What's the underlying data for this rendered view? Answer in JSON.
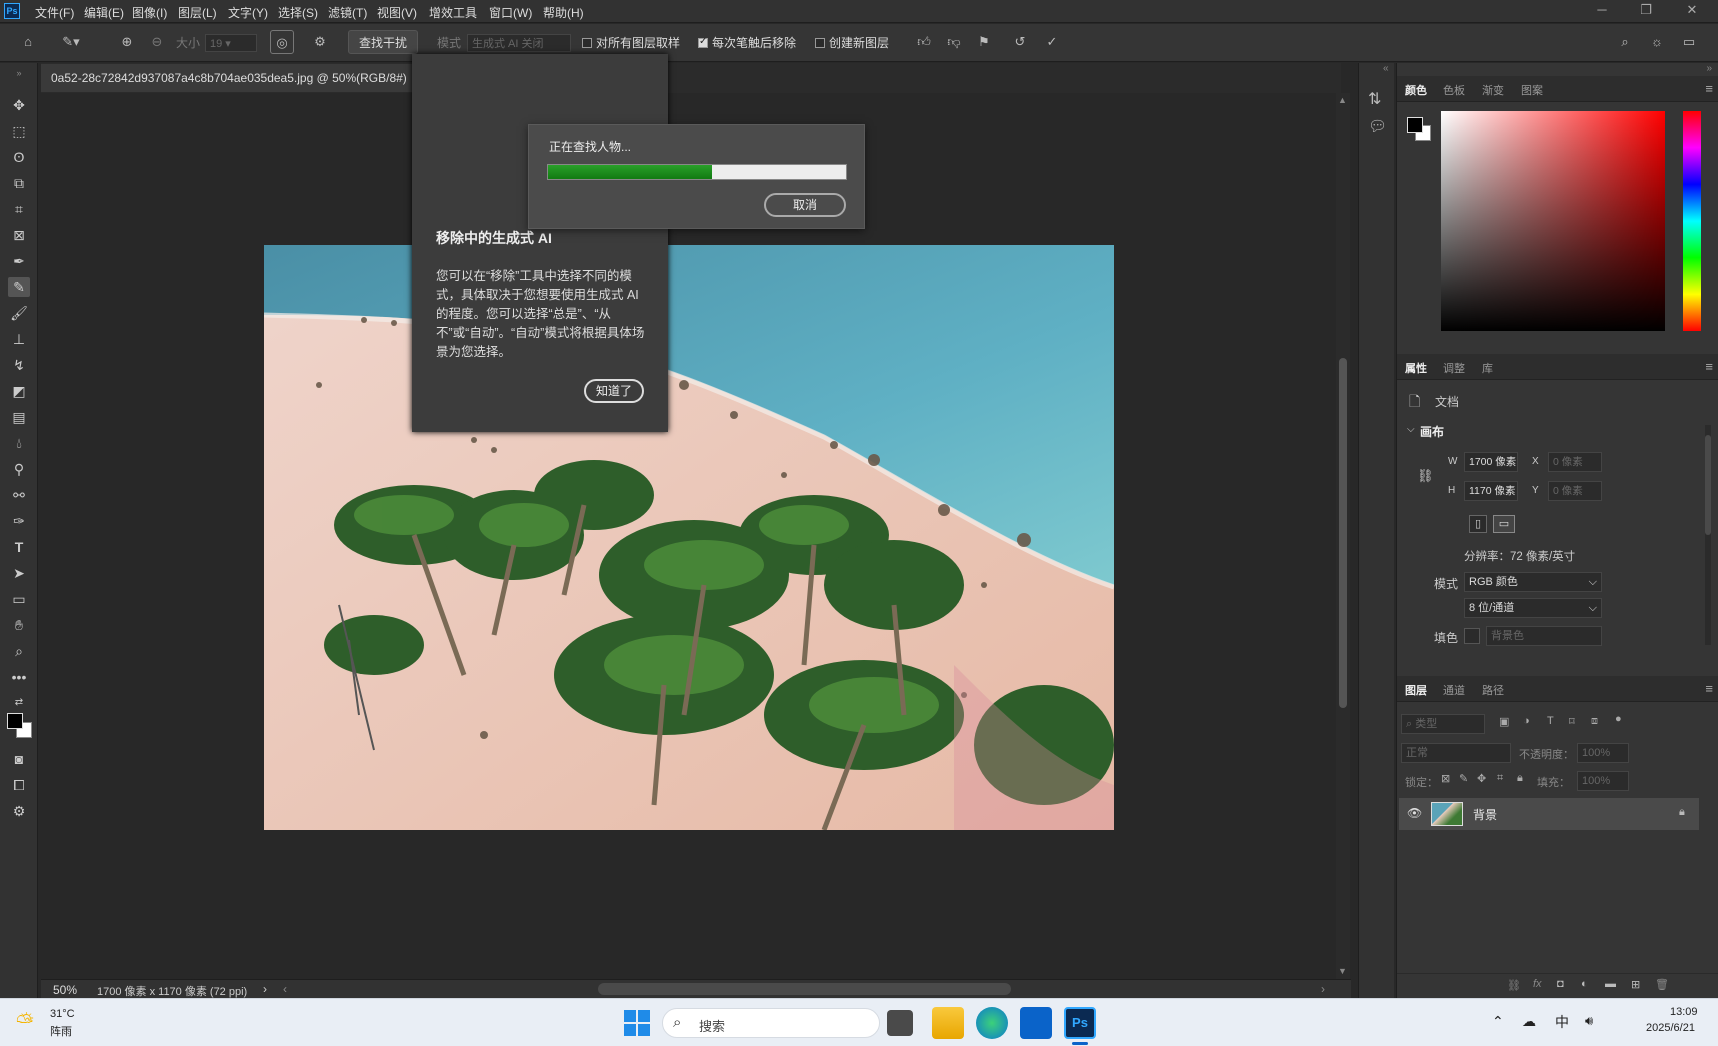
{
  "menu": [
    "文件(F)",
    "编辑(E)",
    "图像(I)",
    "图层(L)",
    "文字(Y)",
    "选择(S)",
    "滤镜(T)",
    "视图(V)",
    "增效工具",
    "窗口(W)",
    "帮助(H)"
  ],
  "options": {
    "size_label": "大小",
    "size_value": "19",
    "find_button": "查找干扰",
    "mode_label": "模式",
    "mode_value": "生成式 AI 关闭",
    "sample_all": "对所有图层取样",
    "remove_after": "每次笔触后移除",
    "new_layer": "创建新图层"
  },
  "document": {
    "tab_title": "0a52-28c72842d937087a4c8b704ae035dea5.jpg @ 50%(RGB/8#)",
    "close": "×"
  },
  "tooltip": {
    "title": "移除中的生成式 AI",
    "body": "您可以在“移除”工具中选择不同的模式，具体取决于您想要使用生成式 AI 的程度。您可以选择“总是”、“从不”或“自动”。“自动”模式将根据具体场景为您选择。",
    "button": "知道了"
  },
  "progress": {
    "text": "正在查找人物...",
    "percent": 55,
    "cancel": "取消"
  },
  "status": {
    "zoom": "50%",
    "info": "1700 像素 x 1170 像素 (72 ppi)",
    "arrow": "›"
  },
  "color_panel": {
    "tabs": [
      "颜色",
      "色板",
      "渐变",
      "图案"
    ],
    "fg": "#000000",
    "bg": "#ffffff",
    "hue": "#ff0000"
  },
  "properties": {
    "tabs": [
      "属性",
      "调整",
      "库"
    ],
    "doc_label": "文档",
    "canvas_label": "画布",
    "w_label": "W",
    "w_value": "1700 像素",
    "h_label": "H",
    "h_value": "1170 像素",
    "x_label": "X",
    "x_value": "0 像素",
    "y_label": "Y",
    "y_value": "0 像素",
    "resolution": "分辨率：72 像素/英寸",
    "mode_label": "模式",
    "mode_value": "RGB 颜色",
    "depth_value": "8 位/通道",
    "fill_label": "填色",
    "fill_value": "背景色"
  },
  "layers": {
    "tabs": [
      "图层",
      "通道",
      "路径"
    ],
    "filter": "类型",
    "blend": "正常",
    "opacity_label": "不透明度：",
    "opacity_value": "100%",
    "lock_label": "锁定：",
    "fill_label": "填充：",
    "fill_value": "100%",
    "items": [
      {
        "name": "背景"
      }
    ]
  },
  "taskbar": {
    "temp": "31°C",
    "weather": "阵雨",
    "search": "搜索",
    "ime": "中",
    "time": "13:09",
    "date": "2025/6/21"
  },
  "colors": {
    "accent": "#31a8ff",
    "progress": "#1f8f1f"
  }
}
